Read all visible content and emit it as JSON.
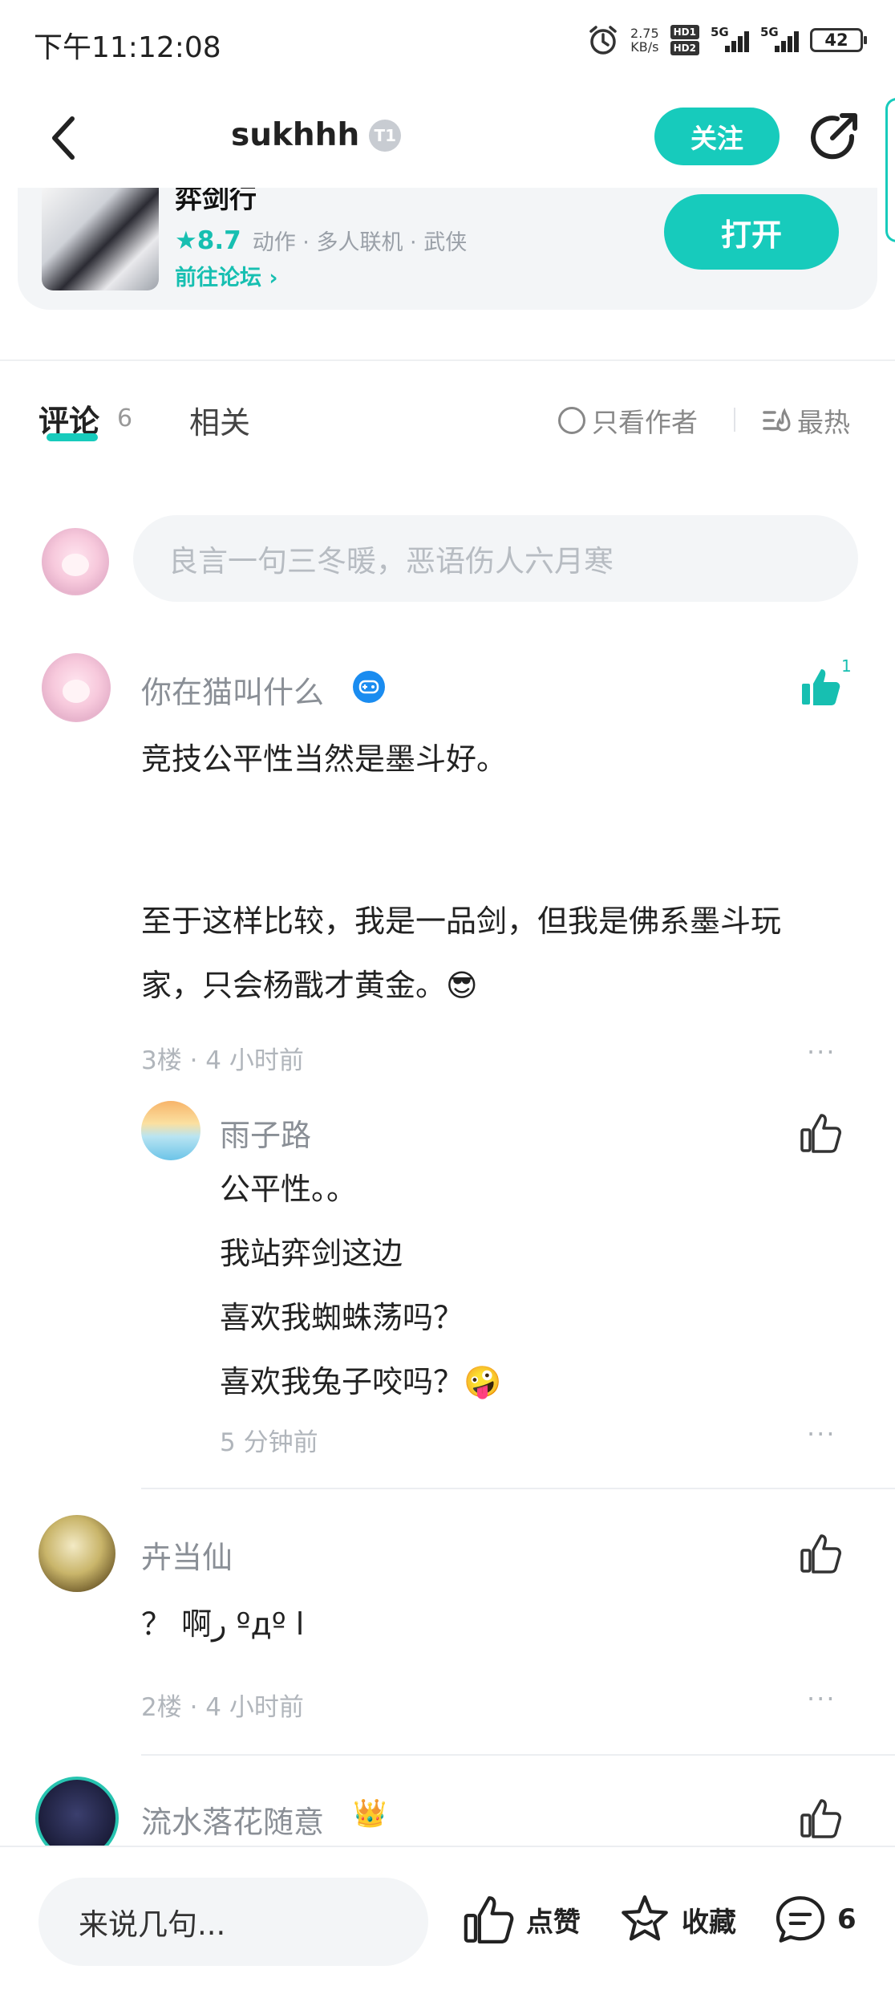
{
  "status_bar": {
    "time": "下午11:12:08",
    "speed_value": "2.75",
    "speed_unit": "KB/s",
    "hd1": "HD1",
    "hd2": "HD2",
    "net1": "5G",
    "net2": "5G",
    "battery": "42"
  },
  "header": {
    "title": "sukhhh",
    "badge": "T1",
    "follow_label": "关注"
  },
  "game": {
    "name": "弈剑行",
    "rating": "★8.7",
    "tags": "动作 · 多人联机 · 武侠",
    "forum_link": "前往论坛 ›",
    "open_label": "打开"
  },
  "tabs": {
    "comments_label": "评论",
    "comments_count": "6",
    "related_label": "相关",
    "author_only_label": "只看作者",
    "sort_label": "最热"
  },
  "composer": {
    "placeholder": "良言一句三冬暖，恶语伤人六月寒"
  },
  "comments": [
    {
      "user": "你在猫叫什么",
      "like_count": "1",
      "lines": [
        "竞技公平性当然是墨斗好。",
        "",
        "至于这样比较，我是一品剑，但我是佛系墨斗玩",
        "家，只会杨戬才黄金。😎"
      ],
      "meta": "3楼 · 4 小时前",
      "more": "···",
      "reply": {
        "user": "雨子路",
        "lines": [
          "公平性。。",
          "我站弈剑这边",
          "喜欢我蜘蛛荡吗？",
          "喜欢我兔子咬吗？🤪"
        ],
        "meta": "5 分钟前",
        "more": "···"
      }
    },
    {
      "user": "卉当仙",
      "lines": [
        "？ 啊ر ºдº ا"
      ],
      "meta": "2楼 · 4 小时前",
      "more": "···"
    },
    {
      "user": "流水落花随意",
      "crown": "👑"
    }
  ],
  "bottom_bar": {
    "input_placeholder": "来说几句...",
    "like_label": "点赞",
    "fav_label": "收藏",
    "comment_count": "6"
  },
  "colors": {
    "accent": "#17cbbc",
    "badge_blue": "#1a8cf0"
  }
}
